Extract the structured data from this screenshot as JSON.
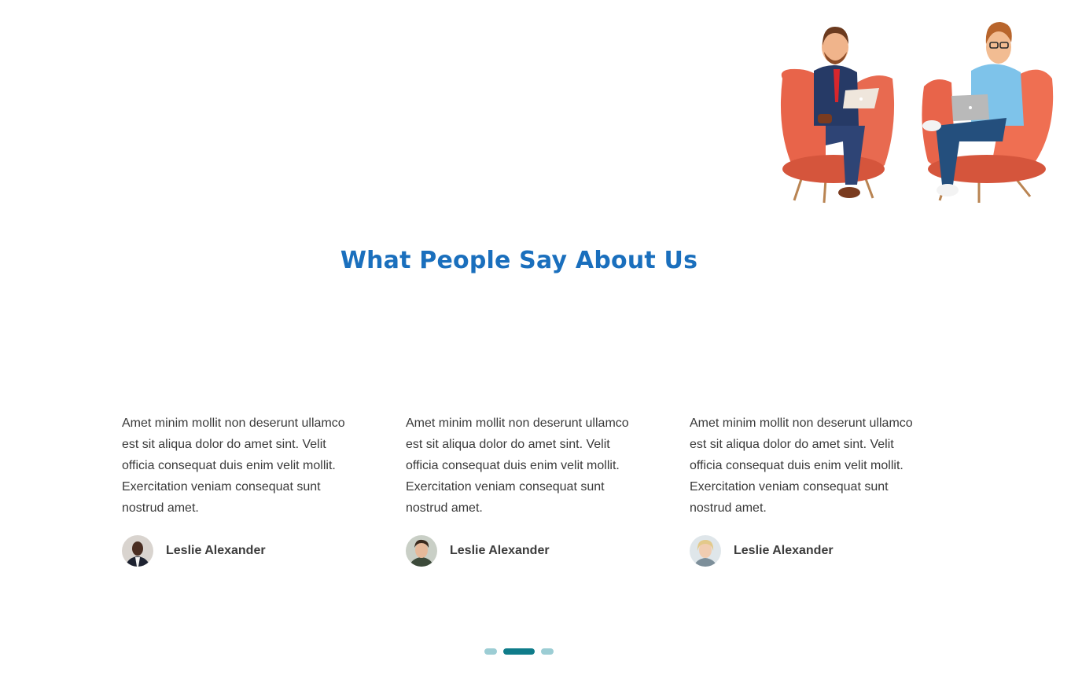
{
  "section": {
    "title": "What People Say About Us"
  },
  "testimonials": [
    {
      "quote": "Amet minim mollit non deserunt ullamco est sit aliqua dolor do amet sint. Velit officia consequat duis enim velit mollit. Exercitation veniam consequat sunt nostrud amet.",
      "author": "Leslie Alexander"
    },
    {
      "quote": "Amet minim mollit non deserunt ullamco est sit aliqua dolor do amet sint. Velit officia consequat duis enim velit mollit. Exercitation veniam consequat sunt nostrud amet.",
      "author": "Leslie Alexander"
    },
    {
      "quote": "Amet minim mollit non deserunt ullamco est sit aliqua dolor do amet sint. Velit officia consequat duis enim velit mollit. Exercitation veniam consequat sunt nostrud amet.",
      "author": "Leslie Alexander"
    }
  ],
  "pager": {
    "count": 3,
    "active_index": 1
  },
  "colors": {
    "title": "#1a6fbd",
    "body_text": "#3a3a3a",
    "pager_active": "#0f7c8a",
    "pager_inactive": "#9ccdd4",
    "chair": "#e8644a"
  }
}
